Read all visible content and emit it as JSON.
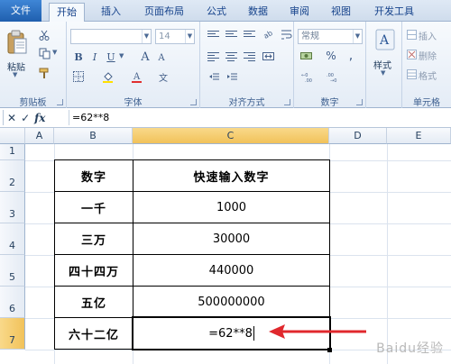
{
  "ribbon_tabs": [
    "文件",
    "开始",
    "插入",
    "页面布局",
    "公式",
    "数据",
    "审阅",
    "视图",
    "开发工具"
  ],
  "ribbon": {
    "clipboard": {
      "paste": "粘贴",
      "label": "剪贴板"
    },
    "font": {
      "size": "14",
      "label": "字体"
    },
    "alignment": {
      "label": "对齐方式"
    },
    "number": {
      "format": "常规",
      "percent": "%",
      "label": "数字"
    },
    "styles": {
      "button": "样式"
    },
    "cells": {
      "insert": "插入",
      "delete": "删除",
      "format": "格式",
      "label": "单元格"
    }
  },
  "formula_bar": {
    "formula": "=62**8"
  },
  "columns": [
    "A",
    "B",
    "C",
    "D",
    "E"
  ],
  "rows": [
    "1",
    "2",
    "3",
    "4",
    "5",
    "6",
    "7"
  ],
  "table": {
    "header": {
      "left": "数字",
      "right": "快速输入数字"
    },
    "rows": [
      {
        "label": "一千",
        "value": "1000"
      },
      {
        "label": "三万",
        "value": "30000"
      },
      {
        "label": "四十四万",
        "value": "440000"
      },
      {
        "label": "五亿",
        "value": "500000000"
      },
      {
        "label": "六十二亿",
        "value": "=62**8"
      }
    ]
  },
  "watermark": "Baidu经验",
  "colors": {
    "file_tab": "#2b6fc2",
    "selected_header": "#f4c96b",
    "arrow": "#e0282d"
  },
  "icons": [
    "cut-icon",
    "copy-icon",
    "format-painter-icon",
    "bold-icon",
    "italic-icon",
    "underline-icon",
    "align-icon",
    "percent-icon",
    "styles-icon",
    "cancel-icon",
    "enter-icon",
    "fx-icon"
  ]
}
